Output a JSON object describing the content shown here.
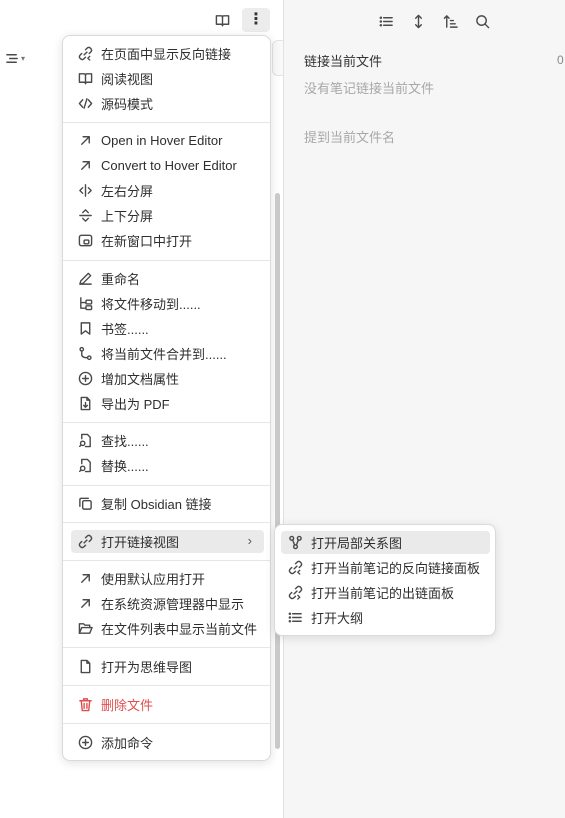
{
  "editor": {
    "reading_icon": "book-open-icon",
    "more_icon": "more-vertical-icon",
    "outline_icon": "outline-list-icon"
  },
  "sidebar": {
    "tools": [
      "list-icon",
      "sort-icon",
      "sort-ascending-icon",
      "search-icon"
    ],
    "linked_title": "链接当前文件",
    "linked_count": "0",
    "linked_empty": "没有笔记链接当前文件",
    "mentions_title": "提到当前文件名"
  },
  "menu": {
    "items": [
      {
        "label": "在页面中显示反向链接",
        "icon": "backlink-icon"
      },
      {
        "label": "阅读视图",
        "icon": "book-open-icon"
      },
      {
        "label": "源码模式",
        "icon": "code-icon"
      },
      {
        "label": "Open in Hover Editor",
        "icon": "arrow-up-right-icon"
      },
      {
        "label": "Convert to Hover Editor",
        "icon": "arrow-up-right-icon"
      },
      {
        "label": "左右分屏",
        "icon": "split-vertical-icon"
      },
      {
        "label": "上下分屏",
        "icon": "split-horizontal-icon"
      },
      {
        "label": "在新窗口中打开",
        "icon": "new-window-icon"
      },
      {
        "label": "重命名",
        "icon": "pencil-icon"
      },
      {
        "label": "将文件移动到......",
        "icon": "folder-tree-icon"
      },
      {
        "label": "书签......",
        "icon": "bookmark-icon"
      },
      {
        "label": "将当前文件合并到......",
        "icon": "merge-icon"
      },
      {
        "label": "增加文档属性",
        "icon": "plus-circle-icon"
      },
      {
        "label": "导出为 PDF",
        "icon": "file-export-icon"
      },
      {
        "label": "查找......",
        "icon": "file-search-icon"
      },
      {
        "label": "替换......",
        "icon": "file-search-icon"
      },
      {
        "label": "复制 Obsidian 链接",
        "icon": "copy-icon"
      },
      {
        "label": "打开链接视图",
        "icon": "link-icon",
        "submenu": true
      },
      {
        "label": "使用默认应用打开",
        "icon": "arrow-up-right-icon"
      },
      {
        "label": "在系统资源管理器中显示",
        "icon": "arrow-up-right-icon"
      },
      {
        "label": "在文件列表中显示当前文件",
        "icon": "folder-open-icon"
      },
      {
        "label": "打开为思维导图",
        "icon": "file-icon"
      },
      {
        "label": "删除文件",
        "icon": "trash-icon",
        "danger": true
      },
      {
        "label": "添加命令",
        "icon": "plus-circle-icon"
      }
    ]
  },
  "submenu": {
    "items": [
      {
        "label": "打开局部关系图",
        "icon": "graph-icon"
      },
      {
        "label": "打开当前笔记的反向链接面板",
        "icon": "backlink-icon"
      },
      {
        "label": "打开当前笔记的出链面板",
        "icon": "outgoing-link-icon"
      },
      {
        "label": "打开大纲",
        "icon": "list-icon"
      }
    ]
  },
  "colors": {
    "danger": "#e04e4e",
    "highlight": "#eaeaea",
    "sidebar_bg": "#f6f6f6"
  }
}
